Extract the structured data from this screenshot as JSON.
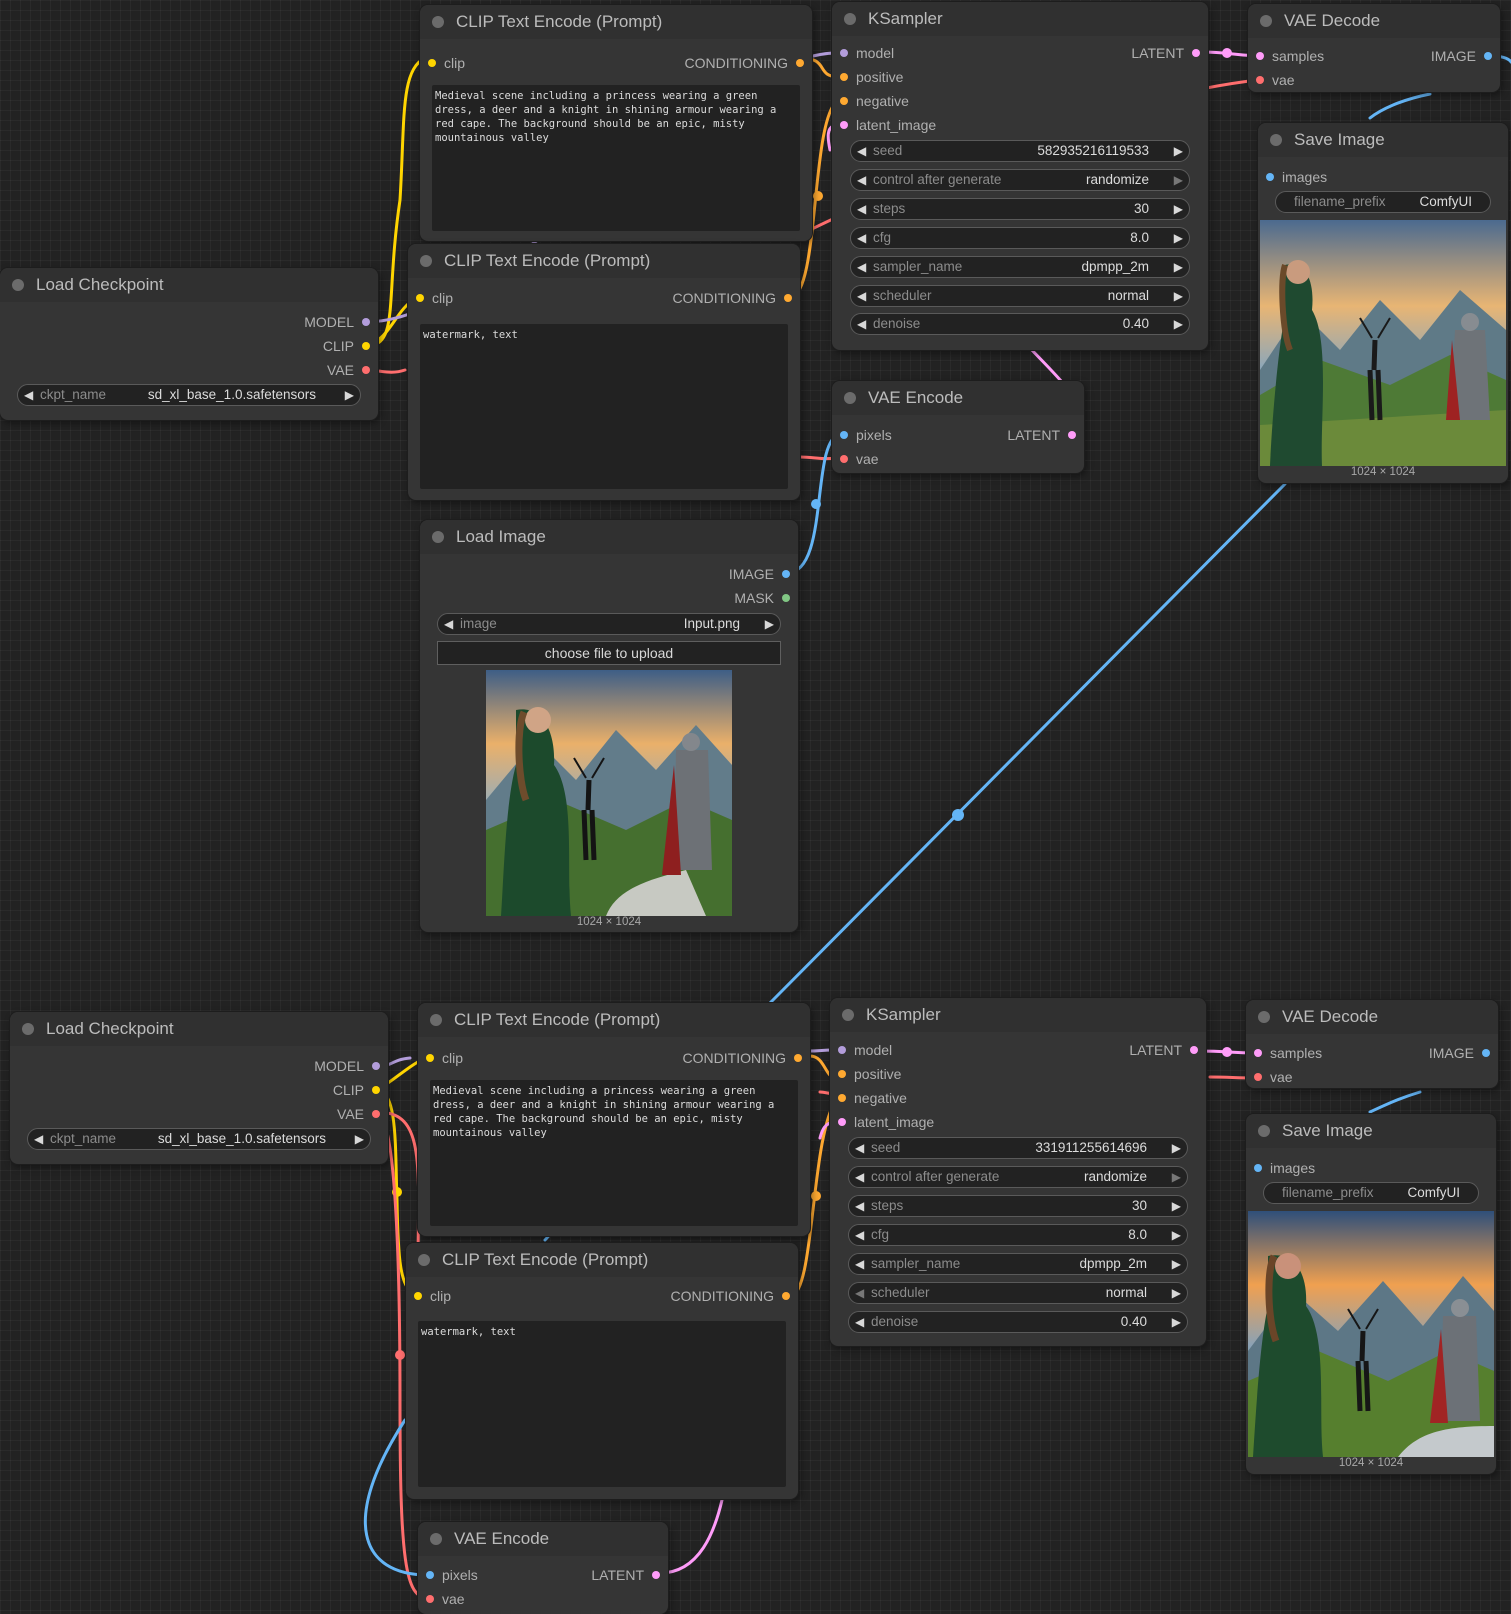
{
  "colors": {
    "model": "#b39ddb",
    "clip": "#ffd500",
    "vae": "#ff6e6e",
    "conditioning": "#ffa931",
    "latent": "#ff9cf9",
    "image": "#64b5f6",
    "mask": "#81c784"
  },
  "top": {
    "clip_pos": {
      "title": "CLIP Text Encode (Prompt)",
      "in_clip": "clip",
      "out": "CONDITIONING",
      "text": "Medieval scene including a princess wearing a green dress, a deer and a knight in shining armour wearing a red cape. The background should be an epic, misty mountainous valley"
    },
    "clip_neg": {
      "title": "CLIP Text Encode (Prompt)",
      "in_clip": "clip",
      "out": "CONDITIONING",
      "text": "watermark, text"
    },
    "checkpoint": {
      "title": "Load Checkpoint",
      "out_model": "MODEL",
      "out_clip": "CLIP",
      "out_vae": "VAE",
      "ckpt_label": "ckpt_name",
      "ckpt_value": "sd_xl_base_1.0.safetensors"
    },
    "ksampler": {
      "title": "KSampler",
      "in_model": "model",
      "in_positive": "positive",
      "in_negative": "negative",
      "in_latent": "latent_image",
      "out": "LATENT",
      "widgets": [
        {
          "name": "seed",
          "value": "582935216119533"
        },
        {
          "name": "control after generate",
          "value": "randomize"
        },
        {
          "name": "steps",
          "value": "30"
        },
        {
          "name": "cfg",
          "value": "8.0"
        },
        {
          "name": "sampler_name",
          "value": "dpmpp_2m"
        },
        {
          "name": "scheduler",
          "value": "normal"
        },
        {
          "name": "denoise",
          "value": "0.40"
        }
      ]
    },
    "vae_decode": {
      "title": "VAE Decode",
      "in_samples": "samples",
      "in_vae": "vae",
      "out": "IMAGE"
    },
    "save_image": {
      "title": "Save Image",
      "in_images": "images",
      "prefix_label": "filename_prefix",
      "prefix_value": "ComfyUI",
      "caption": "1024 × 1024"
    },
    "vae_encode": {
      "title": "VAE Encode",
      "in_pixels": "pixels",
      "in_vae": "vae",
      "out": "LATENT"
    },
    "load_image": {
      "title": "Load Image",
      "out_image": "IMAGE",
      "out_mask": "MASK",
      "image_label": "image",
      "image_value": "Input.png",
      "upload_label": "choose file to upload",
      "caption": "1024 × 1024"
    }
  },
  "bottom": {
    "checkpoint": {
      "title": "Load Checkpoint",
      "out_model": "MODEL",
      "out_clip": "CLIP",
      "out_vae": "VAE",
      "ckpt_label": "ckpt_name",
      "ckpt_value": "sd_xl_base_1.0.safetensors"
    },
    "clip_pos": {
      "title": "CLIP Text Encode (Prompt)",
      "in_clip": "clip",
      "out": "CONDITIONING",
      "text": "Medieval scene including a princess wearing a green dress, a deer and a knight in shining armour wearing a red cape. The background should be an epic, misty mountainous valley"
    },
    "clip_neg": {
      "title": "CLIP Text Encode (Prompt)",
      "in_clip": "clip",
      "out": "CONDITIONING",
      "text": "watermark, text"
    },
    "ksampler": {
      "title": "KSampler",
      "in_model": "model",
      "in_positive": "positive",
      "in_negative": "negative",
      "in_latent": "latent_image",
      "out": "LATENT",
      "widgets": [
        {
          "name": "seed",
          "value": "331911255614696"
        },
        {
          "name": "control after generate",
          "value": "randomize"
        },
        {
          "name": "steps",
          "value": "30"
        },
        {
          "name": "cfg",
          "value": "8.0"
        },
        {
          "name": "sampler_name",
          "value": "dpmpp_2m"
        },
        {
          "name": "scheduler",
          "value": "normal"
        },
        {
          "name": "denoise",
          "value": "0.40"
        }
      ]
    },
    "vae_decode": {
      "title": "VAE Decode",
      "in_samples": "samples",
      "in_vae": "vae",
      "out": "IMAGE"
    },
    "save_image": {
      "title": "Save Image",
      "in_images": "images",
      "prefix_label": "filename_prefix",
      "prefix_value": "ComfyUI",
      "caption": "1024 × 1024"
    },
    "vae_encode": {
      "title": "VAE Encode",
      "in_pixels": "pixels",
      "in_vae": "vae",
      "out": "LATENT"
    }
  }
}
